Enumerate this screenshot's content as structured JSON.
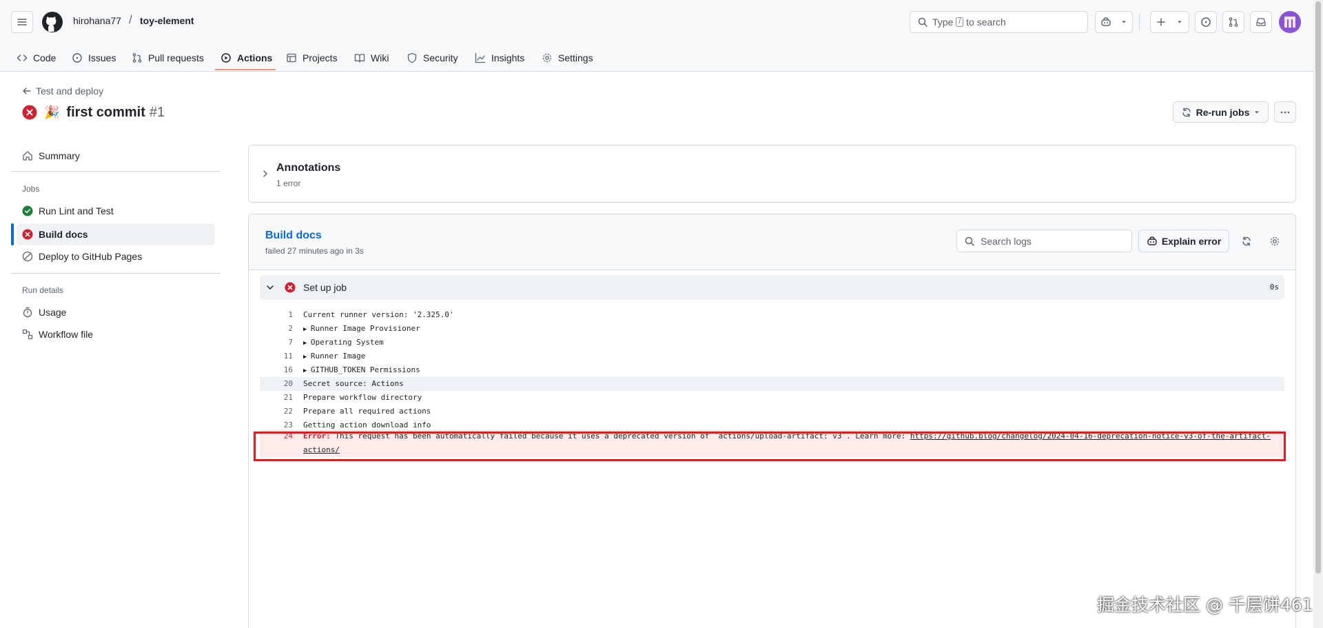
{
  "header": {
    "owner": "hirohana77",
    "separator": "/",
    "repo": "toy-element",
    "search_prefix": "Type",
    "search_key": "/",
    "search_suffix": "to search"
  },
  "tabs": [
    {
      "label": "Code",
      "icon": "code-icon"
    },
    {
      "label": "Issues",
      "icon": "issue-icon"
    },
    {
      "label": "Pull requests",
      "icon": "pull-request-icon"
    },
    {
      "label": "Actions",
      "icon": "play-icon",
      "active": true
    },
    {
      "label": "Projects",
      "icon": "table-icon"
    },
    {
      "label": "Wiki",
      "icon": "book-icon"
    },
    {
      "label": "Security",
      "icon": "shield-icon"
    },
    {
      "label": "Insights",
      "icon": "graph-icon"
    },
    {
      "label": "Settings",
      "icon": "gear-icon"
    }
  ],
  "run": {
    "back_label": "Test and deploy",
    "emoji": "🎉",
    "title": "first commit",
    "number": "#1",
    "status": "failure",
    "rerun_label": "Re-run jobs"
  },
  "sidebar": {
    "summary": "Summary",
    "jobs_heading": "Jobs",
    "jobs": [
      {
        "label": "Run Lint and Test",
        "status": "success"
      },
      {
        "label": "Build docs",
        "status": "failure",
        "active": true
      },
      {
        "label": "Deploy to GitHub Pages",
        "status": "skipped"
      }
    ],
    "run_details_heading": "Run details",
    "usage": "Usage",
    "workflow_file": "Workflow file"
  },
  "annotations": {
    "title": "Annotations",
    "count": "1 error"
  },
  "job": {
    "name": "Build docs",
    "status_text": "failed 27 minutes ago in 3s",
    "search_placeholder": "Search logs",
    "explain_label": "Explain error",
    "step": {
      "name": "Set up job",
      "duration": "0s"
    },
    "lines": [
      {
        "num": "1",
        "text": "Current runner version: '2.325.0'"
      },
      {
        "num": "2",
        "text": "Runner Image Provisioner",
        "collapsible": true
      },
      {
        "num": "7",
        "text": "Operating System",
        "collapsible": true
      },
      {
        "num": "11",
        "text": "Runner Image",
        "collapsible": true
      },
      {
        "num": "16",
        "text": "GITHUB_TOKEN Permissions",
        "collapsible": true
      },
      {
        "num": "20",
        "text": "Secret source: Actions",
        "highlighted": true
      },
      {
        "num": "21",
        "text": "Prepare workflow directory"
      },
      {
        "num": "22",
        "text": "Prepare all required actions"
      },
      {
        "num": "23",
        "text": "Getting action download info"
      }
    ],
    "error_line": {
      "num": "24",
      "label": "Error:",
      "text": "This request has been automatically failed because it uses a deprecated version of `actions/upload-artifact: v3`. Learn more:",
      "link": "https://github.blog/changelog/2024-04-16-deprecation-notice-v3-of-the-artifact-actions/"
    }
  },
  "watermark": "掘金技术社区 @ 千层饼461",
  "colors": {
    "accent": "#0969da",
    "danger": "#d1242f",
    "success": "#1a7f37",
    "tab_underline": "#fd8c73",
    "annotation_box": "#e5191e"
  }
}
